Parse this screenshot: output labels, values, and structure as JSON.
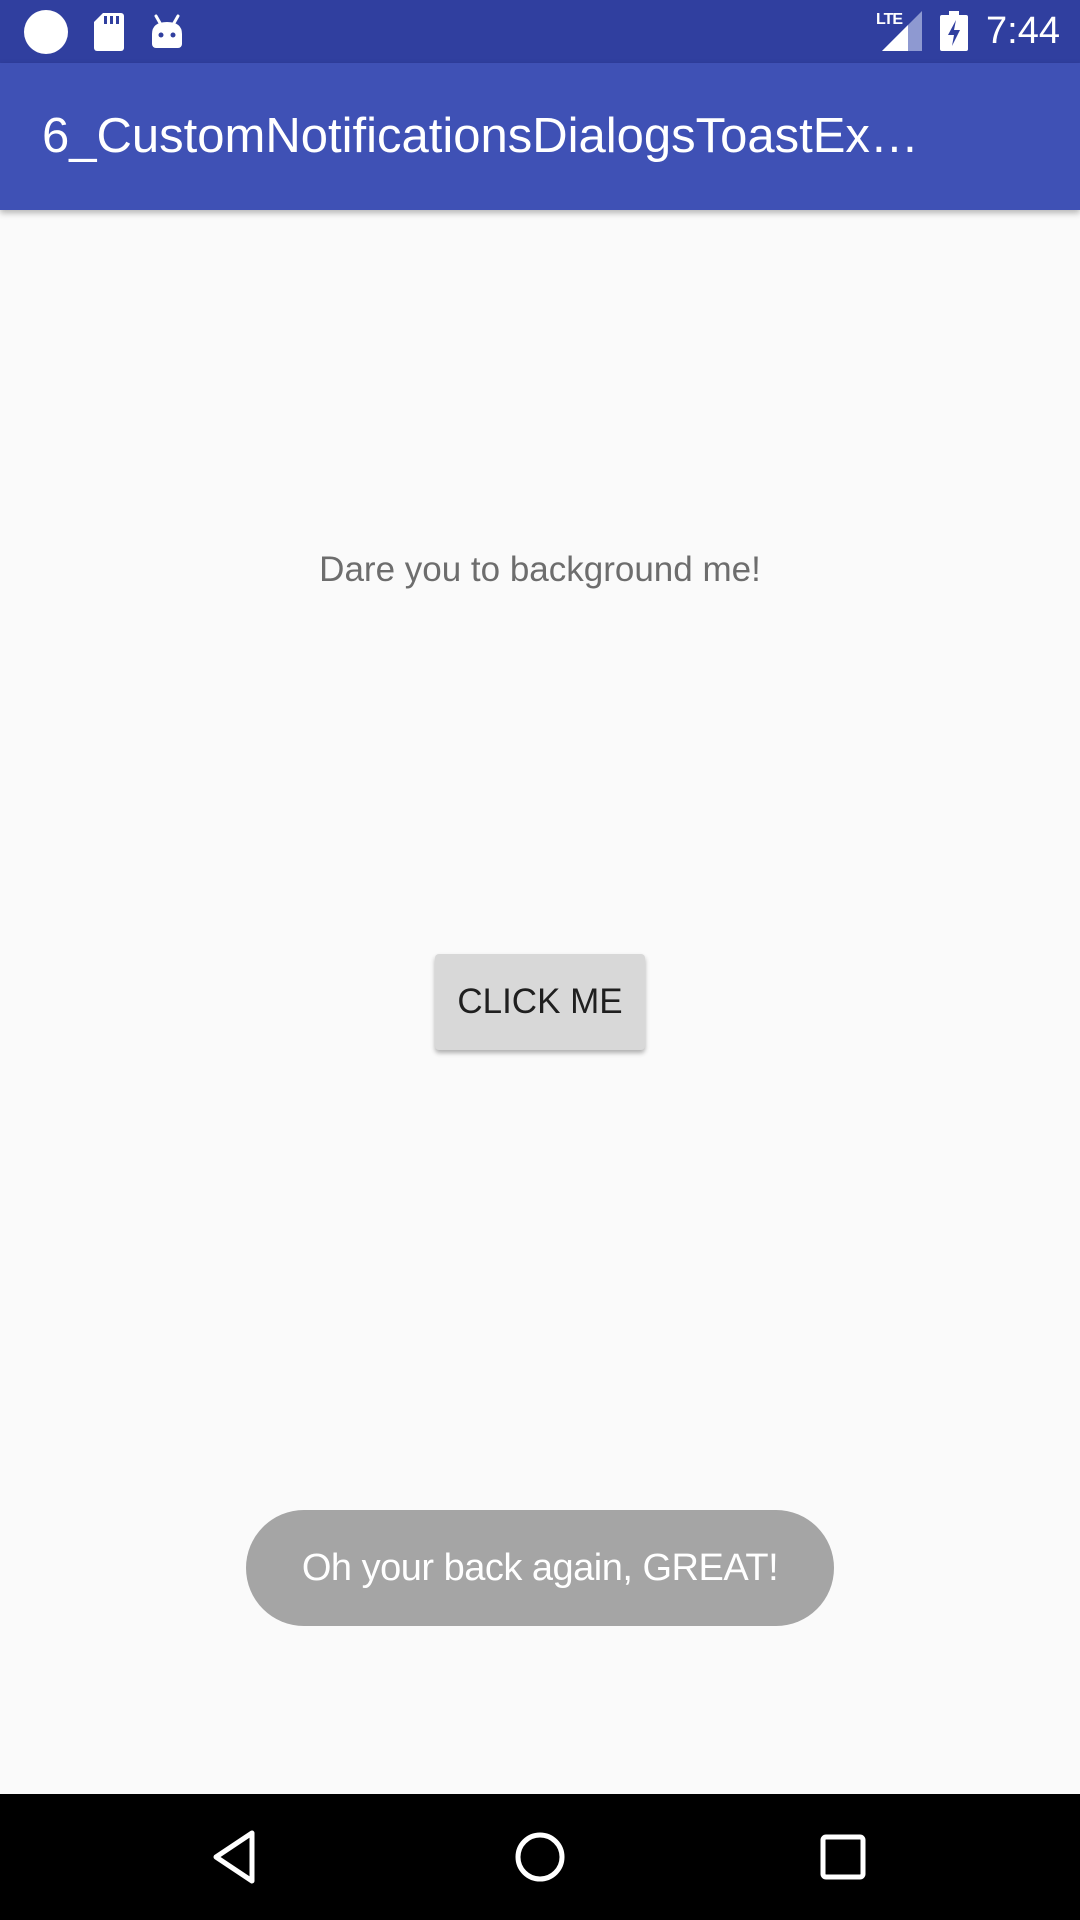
{
  "status_bar": {
    "time": "7:44",
    "network_label": "LTE",
    "icons": [
      "circle-icon",
      "sd-card-icon",
      "android-icon",
      "signal-icon",
      "battery-charging-icon"
    ]
  },
  "app_bar": {
    "title": "6_CustomNotificationsDialogsToastEx…"
  },
  "main": {
    "message": "Dare you to background me!",
    "button_label": "CLICK ME"
  },
  "toast": {
    "text": "Oh your back again, GREAT!"
  },
  "nav_bar": {
    "icons": [
      "back-icon",
      "home-icon",
      "recents-icon"
    ]
  },
  "colors": {
    "status_bar": "#303f9f",
    "app_bar": "#3f51b5",
    "background": "#fafafa",
    "button": "#d8d8d8",
    "toast": "#a5a5a5",
    "nav_bar": "#000000"
  }
}
